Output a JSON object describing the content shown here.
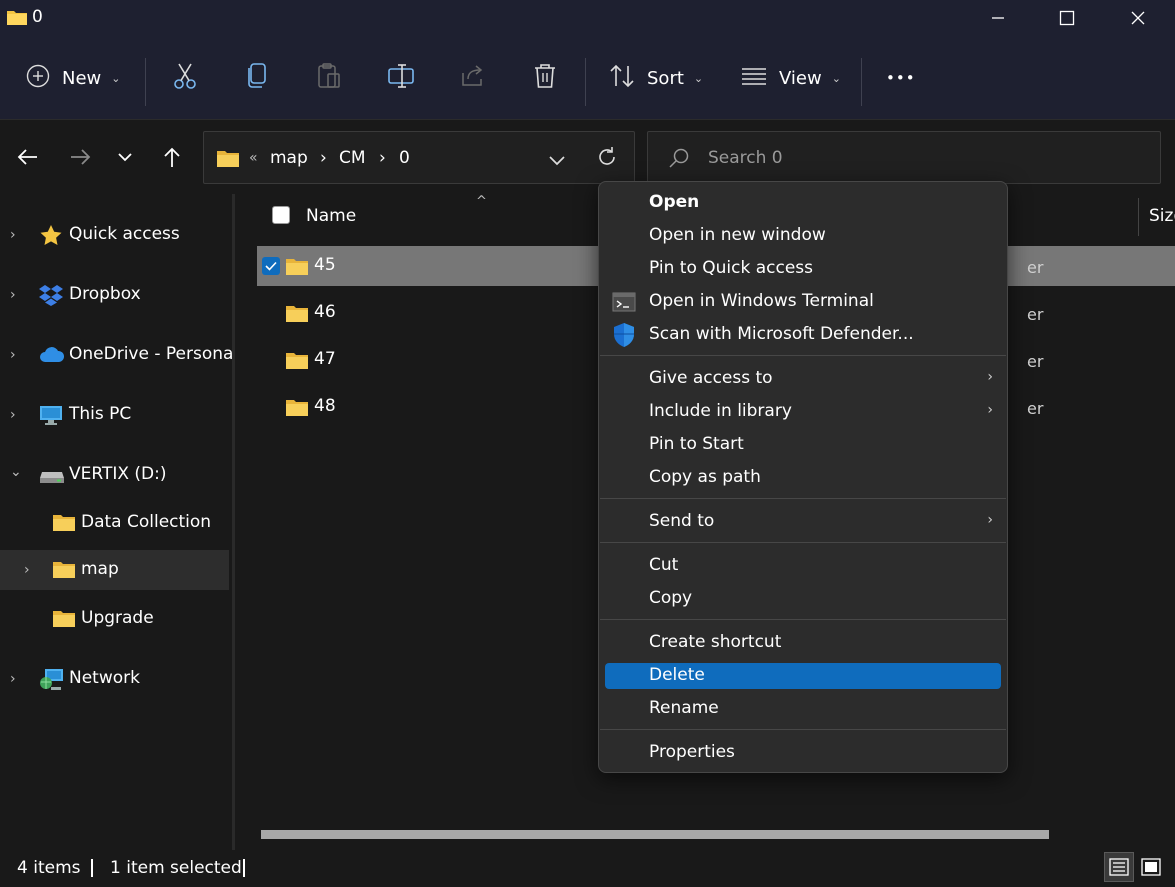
{
  "window": {
    "title": "0",
    "minimize_glyph": "—",
    "maximize_glyph": "☐",
    "close_glyph": "✕"
  },
  "toolbar": {
    "new_label": "New",
    "sort_label": "Sort",
    "view_label": "View",
    "caret": "⌄",
    "more_glyph": "•••"
  },
  "address": {
    "overflow": "«",
    "crumbs": [
      "map",
      "CM",
      "0"
    ],
    "separator": "›",
    "search_placeholder": "Search 0"
  },
  "sidebar": {
    "chevron_right": "›",
    "chevron_down": "⌄",
    "items": [
      {
        "label": "Quick access"
      },
      {
        "label": "Dropbox"
      },
      {
        "label": "OneDrive - Personal"
      },
      {
        "label": "This PC"
      },
      {
        "label": "VERTIX (D:)"
      },
      {
        "label": "Data Collection"
      },
      {
        "label": "map"
      },
      {
        "label": "Upgrade"
      },
      {
        "label": "Network"
      }
    ]
  },
  "filelist": {
    "header_name": "Name",
    "header_size": "Size",
    "sort_arrow": "^",
    "rows": [
      {
        "name": "45",
        "type_fragment": "er"
      },
      {
        "name": "46",
        "type_fragment": "er"
      },
      {
        "name": "47",
        "type_fragment": "er"
      },
      {
        "name": "48",
        "type_fragment": "er"
      }
    ]
  },
  "status": {
    "count": "4 items",
    "selected": "1 item selected"
  },
  "context_menu": {
    "submenu_arrow": "›",
    "items": {
      "open": "Open",
      "open_new_window": "Open in new window",
      "pin_quick_access": "Pin to Quick access",
      "open_terminal": "Open in Windows Terminal",
      "scan_defender": "Scan with Microsoft Defender...",
      "give_access": "Give access to",
      "include_library": "Include in library",
      "pin_start": "Pin to Start",
      "copy_path": "Copy as path",
      "send_to": "Send to",
      "cut": "Cut",
      "copy": "Copy",
      "create_shortcut": "Create shortcut",
      "delete": "Delete",
      "rename": "Rename",
      "properties": "Properties"
    }
  },
  "colors": {
    "accent": "#0f6cbd",
    "folder": "#f4c542",
    "background": "#191919",
    "toolbar": "#1e2030",
    "menu": "#2c2c2c"
  }
}
